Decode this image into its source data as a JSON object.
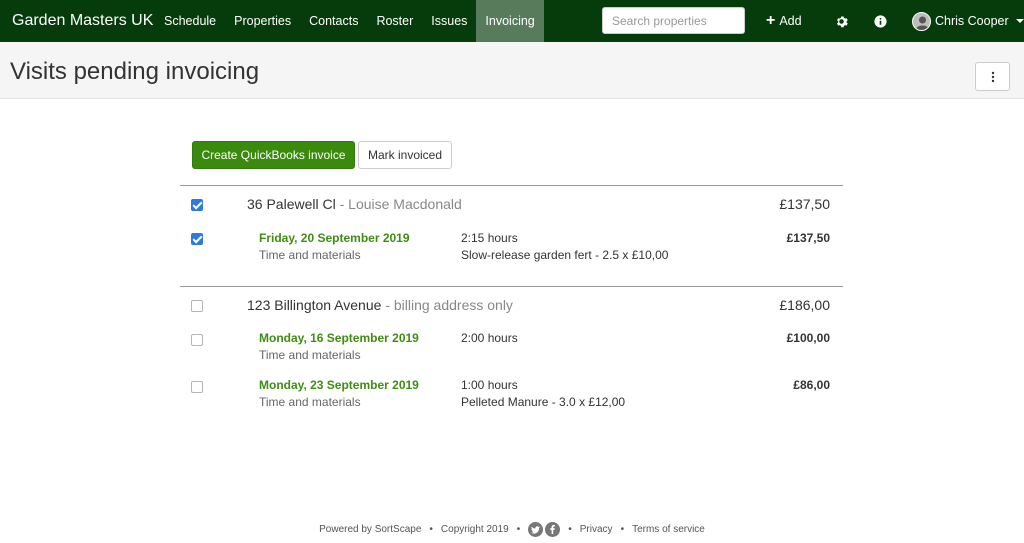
{
  "navbar": {
    "brand": "Garden Masters UK",
    "items": [
      {
        "label": "Schedule",
        "active": false
      },
      {
        "label": "Properties",
        "active": false
      },
      {
        "label": "Contacts",
        "active": false
      },
      {
        "label": "Roster",
        "active": false
      },
      {
        "label": "Issues",
        "active": false
      },
      {
        "label": "Invoicing",
        "active": true
      }
    ],
    "search_placeholder": "Search properties",
    "add_label": "Add",
    "user_name": "Chris Cooper"
  },
  "header": {
    "title": "Visits pending invoicing"
  },
  "actions": {
    "create_invoice_label": "Create QuickBooks invoice",
    "mark_invoiced_label": "Mark invoiced"
  },
  "properties": [
    {
      "name": "36 Palewell Cl",
      "subtitle": " - Louise Macdonald",
      "amount": "£137,50",
      "checked": true,
      "visits": [
        {
          "date": "Friday, 20 September 2019",
          "type": "Time and materials",
          "hours": "2:15 hours",
          "material": "Slow-release garden fert - 2.5 x £10,00",
          "amount": "£137,50",
          "checked": true
        }
      ]
    },
    {
      "name": "123 Billington Avenue",
      "subtitle": " - billing address only",
      "amount": "£186,00",
      "checked": false,
      "visits": [
        {
          "date": "Monday, 16 September 2019",
          "type": "Time and materials",
          "hours": "2:00 hours",
          "material": "",
          "amount": "£100,00",
          "checked": false
        },
        {
          "date": "Monday, 23 September 2019",
          "type": "Time and materials",
          "hours": "1:00 hours",
          "material": "Pelleted Manure - 3.0 x £12,00",
          "amount": "£86,00",
          "checked": false
        }
      ]
    }
  ],
  "footer": {
    "powered_by": "Powered by SortScape",
    "copyright": "Copyright 2019",
    "privacy": "Privacy",
    "terms": "Terms of service",
    "separator": "•"
  },
  "colors": {
    "navbar_bg": "#063c0b",
    "active_nav_bg": "#587b5c",
    "primary_button": "#3a8a0e",
    "visit_date": "#3e8e13",
    "checkbox_checked": "#2c7be5"
  }
}
